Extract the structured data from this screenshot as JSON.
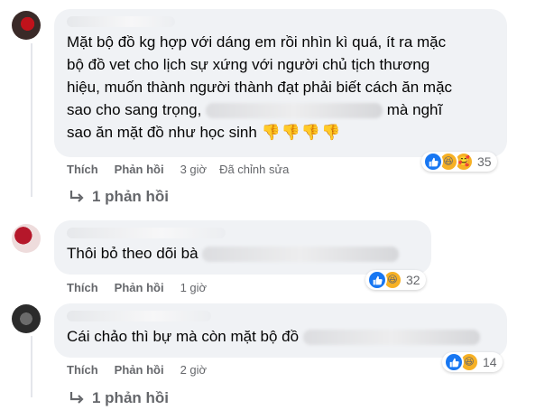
{
  "comments": [
    {
      "text_part1": "Mặt bộ đồ kg hợp với dáng em rồi nhìn kì quá, ít ra mặc\nbộ đồ vet cho lịch sự xứng với người chủ tịch thương\nhiệu, muốn thành người thành đạt phải biết cách ăn mặc\nsao cho sang trọng, ",
      "text_part2": " mà nghĩ\nsao ăn mặt đồ như học sinh ",
      "emoji": "👎👎👎👎",
      "like_label": "Thích",
      "reply_label": "Phản hồi",
      "time": "3 giờ",
      "edited": "Đã chỉnh sửa",
      "reaction_count": "35",
      "replies_label": "1 phản hồi"
    },
    {
      "text_part1": "Thôi bỏ theo dõi bà",
      "like_label": "Thích",
      "reply_label": "Phản hồi",
      "time": "1 giờ",
      "reaction_count": "32"
    },
    {
      "text_part1": "Cái chảo thì bự mà còn mặt bộ đồ",
      "like_label": "Thích",
      "reply_label": "Phản hồi",
      "time": "2 giờ",
      "reaction_count": "14",
      "replies_label": "1 phản hồi"
    }
  ],
  "colors": {
    "bubble": "#f0f2f5",
    "meta_text": "#65676b",
    "like_blue": "#1877f2",
    "haha_yellow": "#f7b125"
  },
  "icons": [
    "like-icon",
    "haha-icon",
    "care-icon",
    "reply-arrow-icon",
    "thumbs-down-emoji"
  ]
}
